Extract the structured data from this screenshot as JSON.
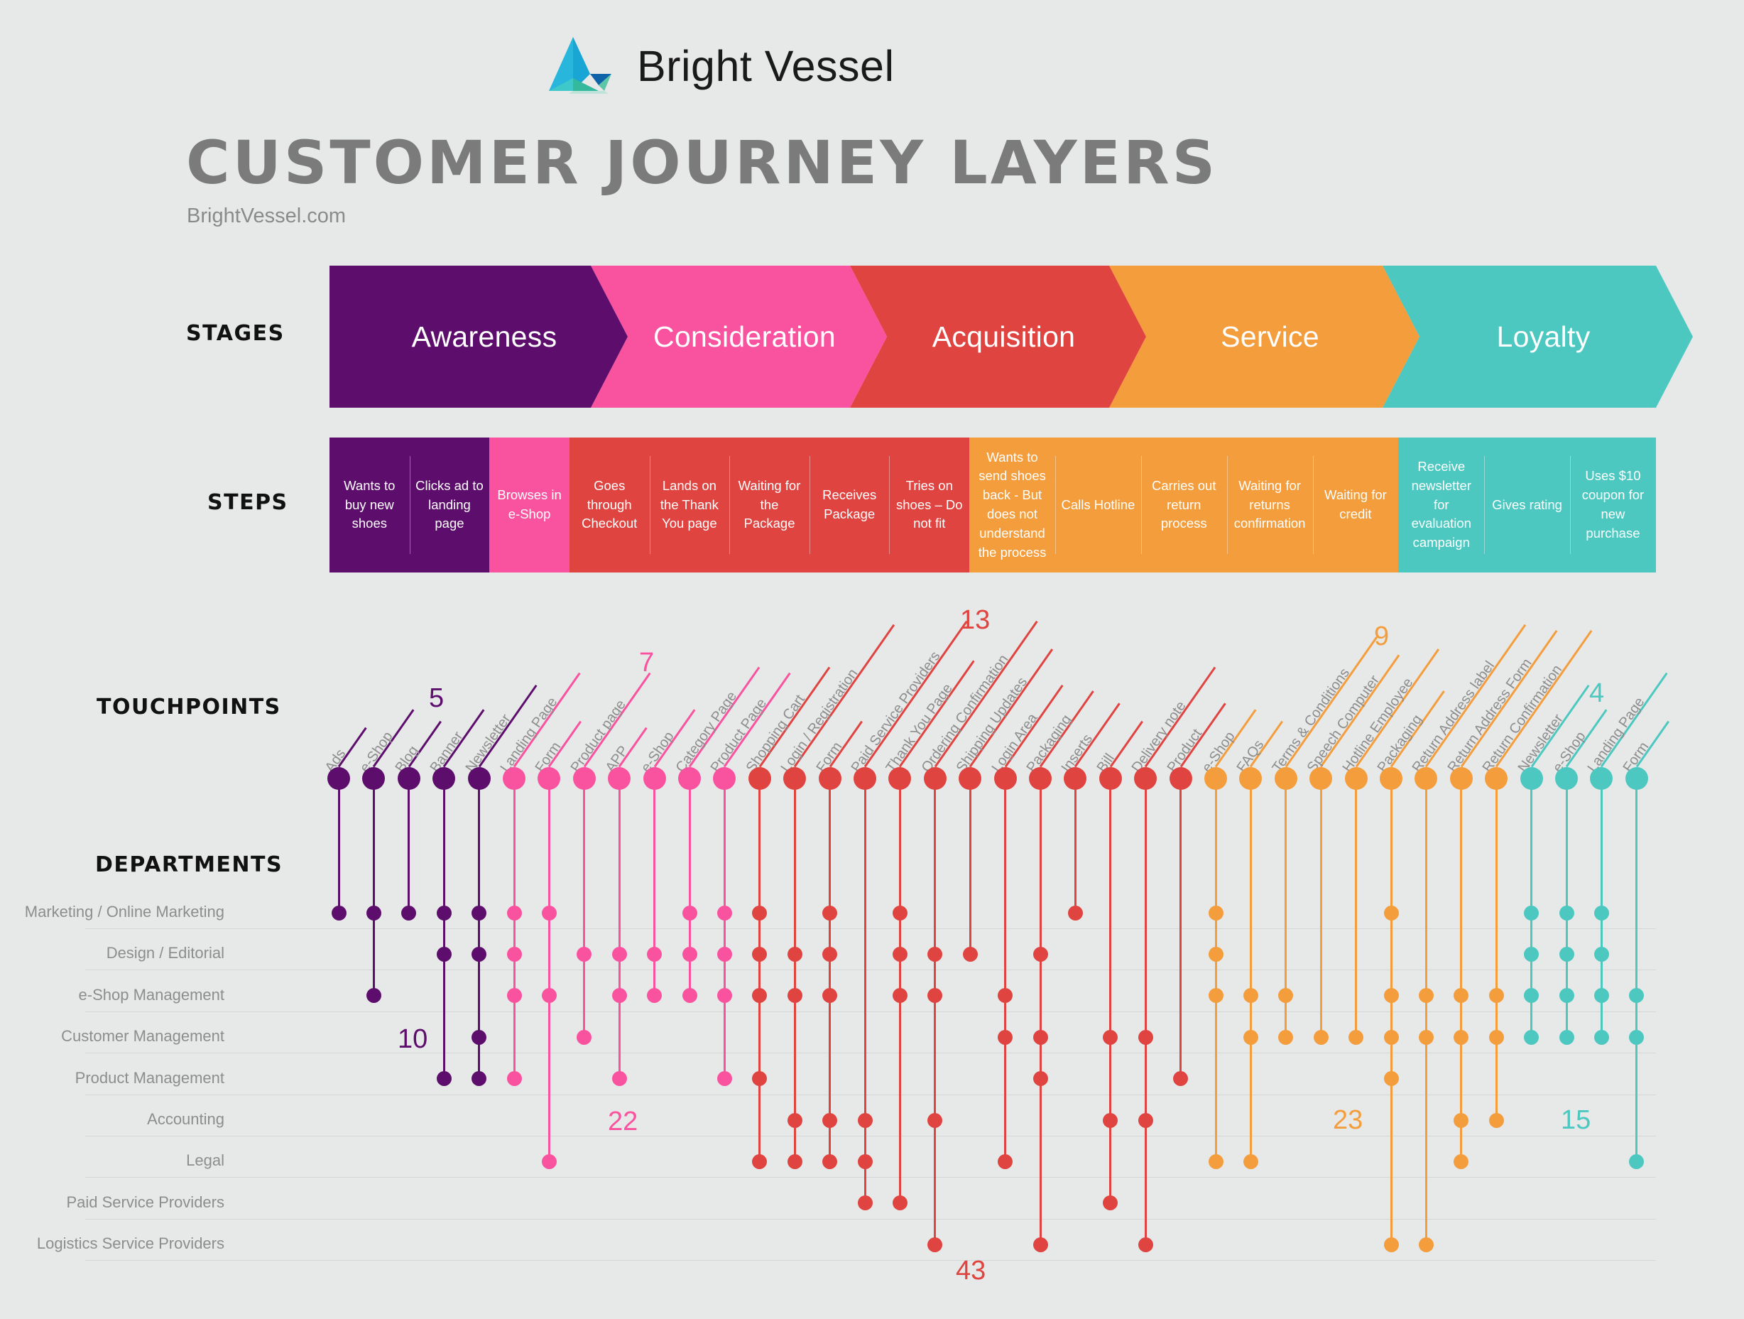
{
  "brand": {
    "name": "Bright Vessel",
    "logo_icon": "bright-vessel-sail-logo"
  },
  "header": {
    "title": "CUSTOMER JOURNEY LAYERS",
    "subtitle": "BrightVessel.com"
  },
  "row_labels": {
    "stages": "STAGES",
    "steps": "STEPS",
    "touchpoints": "TOUCHPOINTS",
    "departments": "DEPARTMENTS"
  },
  "colors": {
    "awareness": "#5d0e6c",
    "consideration": "#f9539f",
    "acquisition": "#e04440",
    "service": "#f49d3c",
    "loyalty": "#4cc8c0",
    "background": "#e7e8e8",
    "title_gray": "#7b7b7b",
    "label_gray": "#8d8d8d",
    "gridline": "#d5d6d6"
  },
  "stages": [
    {
      "label": "Awareness",
      "color": "#5d0e6c",
      "steps": 2
    },
    {
      "label": "Consideration",
      "color": "#f9539f",
      "steps": 1
    },
    {
      "label": "Acquisition",
      "color": "#e04440",
      "steps": 5
    },
    {
      "label": "Service",
      "color": "#f49d3c",
      "steps": 5
    },
    {
      "label": "Loyalty",
      "color": "#4cc8c0",
      "steps": 3
    }
  ],
  "steps": [
    {
      "label": "Wants to buy new shoes",
      "stage": "Awareness",
      "color": "#5d0e6c",
      "width": 110
    },
    {
      "label": "Clicks ad to landing page",
      "stage": "Awareness",
      "color": "#5d0e6c",
      "width": 110
    },
    {
      "label": "Browses in e-Shop",
      "stage": "Consideration",
      "color": "#f9539f",
      "width": 110
    },
    {
      "label": "Goes through Checkout",
      "stage": "Acquisition",
      "color": "#e04440",
      "width": 110
    },
    {
      "label": "Lands on the Thank You page",
      "stage": "Acquisition",
      "color": "#e04440",
      "width": 110
    },
    {
      "label": "Waiting for the Package",
      "stage": "Acquisition",
      "color": "#e04440",
      "width": 110
    },
    {
      "label": "Receives Package",
      "stage": "Acquisition",
      "color": "#e04440",
      "width": 110
    },
    {
      "label": "Tries on shoes – Do not fit",
      "stage": "Acquisition",
      "color": "#e04440",
      "width": 110
    },
    {
      "label": "Wants to send shoes back - But does not understand the process",
      "stage": "Service",
      "color": "#f49d3c",
      "width": 118
    },
    {
      "label": "Calls Hotline",
      "stage": "Service",
      "color": "#f49d3c",
      "width": 118
    },
    {
      "label": "Carries out return process",
      "stage": "Service",
      "color": "#f49d3c",
      "width": 118
    },
    {
      "label": "Waiting for returns confirmation",
      "stage": "Service",
      "color": "#f49d3c",
      "width": 118
    },
    {
      "label": "Waiting for credit",
      "stage": "Service",
      "color": "#f49d3c",
      "width": 118
    },
    {
      "label": "Receive newsletter for evaluation campaign",
      "stage": "Loyalty",
      "color": "#4cc8c0",
      "width": 118
    },
    {
      "label": "Gives rating",
      "stage": "Loyalty",
      "color": "#4cc8c0",
      "width": 118
    },
    {
      "label": "Uses $10 coupon for new purchase",
      "stage": "Loyalty",
      "color": "#4cc8c0",
      "width": 118
    }
  ],
  "departments": [
    "Marketing / Online Marketing",
    "Design / Editorial",
    "e-Shop Management",
    "Customer Management",
    "Product Management",
    "Accounting",
    "Legal",
    "Paid Service Providers",
    "Logistics Service Providers"
  ],
  "stage_counts": [
    {
      "stage": "Awareness",
      "touchpoints": 5,
      "departments": 10,
      "color": "#5d0e6c"
    },
    {
      "stage": "Consideration",
      "touchpoints": 7,
      "departments": 22,
      "color": "#f9539f"
    },
    {
      "stage": "Acquisition",
      "touchpoints": 13,
      "departments": 43,
      "color": "#e04440"
    },
    {
      "stage": "Service",
      "touchpoints": 9,
      "departments": 23,
      "color": "#f49d3c"
    },
    {
      "stage": "Loyalty",
      "touchpoints": 4,
      "departments": 15,
      "color": "#4cc8c0"
    }
  ],
  "chart_data": {
    "type": "scatter",
    "title": "CUSTOMER JOURNEY LAYERS",
    "xlabel": "TOUCHPOINTS",
    "ylabel": "DEPARTMENTS",
    "grid": true,
    "legend": "none",
    "y_categories": [
      "Marketing / Online Marketing",
      "Design / Editorial",
      "e-Shop Management",
      "Customer Management",
      "Product Management",
      "Accounting",
      "Legal",
      "Paid Service Providers",
      "Logistics Service Providers"
    ],
    "touchpoints": [
      {
        "label": "Ads",
        "stage": "Awareness",
        "color": "#5d0e6c",
        "departments": [
          0
        ]
      },
      {
        "label": "e-Shop",
        "stage": "Awareness",
        "color": "#5d0e6c",
        "departments": [
          0,
          2
        ]
      },
      {
        "label": "Blog",
        "stage": "Awareness",
        "color": "#5d0e6c",
        "departments": [
          0
        ]
      },
      {
        "label": "Banner",
        "stage": "Awareness",
        "color": "#5d0e6c",
        "departments": [
          0,
          1,
          4
        ]
      },
      {
        "label": "Newsletter",
        "stage": "Awareness",
        "color": "#5d0e6c",
        "departments": [
          0,
          1,
          3,
          4
        ]
      },
      {
        "label": "Landing Page",
        "stage": "Consideration",
        "color": "#f9539f",
        "departments": [
          0,
          1,
          2,
          4
        ]
      },
      {
        "label": "Form",
        "stage": "Consideration",
        "color": "#f9539f",
        "departments": [
          0,
          2,
          6
        ]
      },
      {
        "label": "Product page",
        "stage": "Consideration",
        "color": "#f9539f",
        "departments": [
          1,
          3
        ]
      },
      {
        "label": "APP",
        "stage": "Consideration",
        "color": "#f9539f",
        "departments": [
          1,
          2,
          4
        ]
      },
      {
        "label": "e-Shop",
        "stage": "Consideration",
        "color": "#f9539f",
        "departments": [
          1,
          2
        ]
      },
      {
        "label": "Category Page",
        "stage": "Consideration",
        "color": "#f9539f",
        "departments": [
          0,
          1,
          2
        ]
      },
      {
        "label": "Product Page",
        "stage": "Consideration",
        "color": "#f9539f",
        "departments": [
          0,
          1,
          2,
          4
        ]
      },
      {
        "label": "Shopping Cart",
        "stage": "Acquisition",
        "color": "#e04440",
        "departments": [
          0,
          1,
          2,
          4,
          6
        ]
      },
      {
        "label": "Login / Registration",
        "stage": "Acquisition",
        "color": "#e04440",
        "departments": [
          1,
          2,
          5,
          6
        ]
      },
      {
        "label": "Form",
        "stage": "Acquisition",
        "color": "#e04440",
        "departments": [
          0,
          1,
          2,
          5,
          6
        ]
      },
      {
        "label": "Paid Service Providers",
        "stage": "Acquisition",
        "color": "#e04440",
        "departments": [
          5,
          6,
          7
        ]
      },
      {
        "label": "Thank You Page",
        "stage": "Acquisition",
        "color": "#e04440",
        "departments": [
          0,
          1,
          2,
          7
        ]
      },
      {
        "label": "Ordering Confirmation",
        "stage": "Acquisition",
        "color": "#e04440",
        "departments": [
          1,
          2,
          5,
          8
        ]
      },
      {
        "label": "Shipping Updates",
        "stage": "Acquisition",
        "color": "#e04440",
        "departments": [
          1
        ]
      },
      {
        "label": "Login Area",
        "stage": "Acquisition",
        "color": "#e04440",
        "departments": [
          2,
          3,
          6
        ]
      },
      {
        "label": "Packaging",
        "stage": "Acquisition",
        "color": "#e04440",
        "departments": [
          1,
          3,
          4,
          8
        ]
      },
      {
        "label": "Inserts",
        "stage": "Acquisition",
        "color": "#e04440",
        "departments": [
          0
        ]
      },
      {
        "label": "Bill",
        "stage": "Acquisition",
        "color": "#e04440",
        "departments": [
          3,
          5,
          7
        ]
      },
      {
        "label": "Delivery note",
        "stage": "Acquisition",
        "color": "#e04440",
        "departments": [
          3,
          5,
          8
        ]
      },
      {
        "label": "Product",
        "stage": "Acquisition",
        "color": "#e04440",
        "departments": [
          4
        ]
      },
      {
        "label": "e-Shop",
        "stage": "Service",
        "color": "#f49d3c",
        "departments": [
          0,
          1,
          2,
          6
        ]
      },
      {
        "label": "FAQs",
        "stage": "Service",
        "color": "#f49d3c",
        "departments": [
          2,
          3,
          6
        ]
      },
      {
        "label": "Terms & Conditions",
        "stage": "Service",
        "color": "#f49d3c",
        "departments": [
          2,
          3
        ]
      },
      {
        "label": "Speech Computer",
        "stage": "Service",
        "color": "#f49d3c",
        "departments": [
          3
        ]
      },
      {
        "label": "Hotline Employee",
        "stage": "Service",
        "color": "#f49d3c",
        "departments": [
          3
        ]
      },
      {
        "label": "Packaging",
        "stage": "Service",
        "color": "#f49d3c",
        "departments": [
          0,
          2,
          3,
          4,
          8
        ]
      },
      {
        "label": "Return Address label",
        "stage": "Service",
        "color": "#f49d3c",
        "departments": [
          2,
          3,
          8
        ]
      },
      {
        "label": "Return Address Form",
        "stage": "Service",
        "color": "#f49d3c",
        "departments": [
          2,
          3,
          5,
          6
        ]
      },
      {
        "label": "Return Confirmation",
        "stage": "Service",
        "color": "#f49d3c",
        "departments": [
          2,
          3,
          5
        ]
      },
      {
        "label": "Newsletter",
        "stage": "Loyalty",
        "color": "#4cc8c0",
        "departments": [
          0,
          1,
          2,
          3
        ]
      },
      {
        "label": "e-Shop",
        "stage": "Loyalty",
        "color": "#4cc8c0",
        "departments": [
          0,
          1,
          2,
          3
        ]
      },
      {
        "label": "Landing Page",
        "stage": "Loyalty",
        "color": "#4cc8c0",
        "departments": [
          0,
          1,
          2,
          3
        ]
      },
      {
        "label": "Form",
        "stage": "Loyalty",
        "color": "#4cc8c0",
        "departments": [
          2,
          3,
          6
        ]
      }
    ]
  }
}
